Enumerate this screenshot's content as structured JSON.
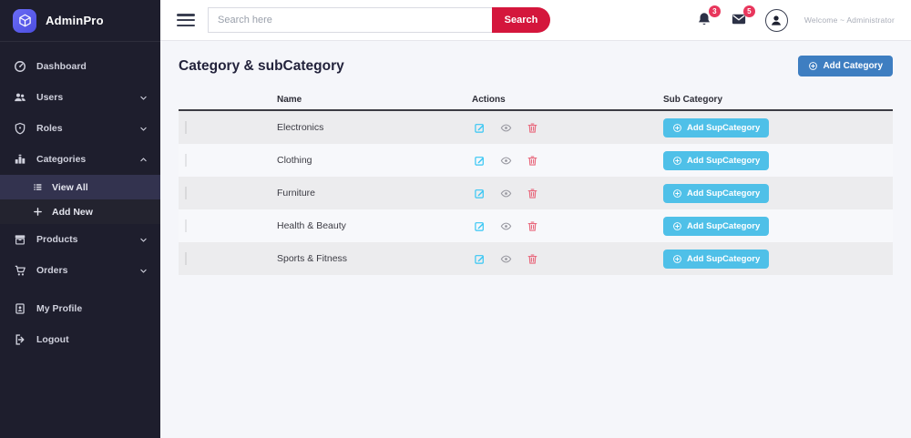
{
  "app": {
    "brand": "AdminPro"
  },
  "colors": {
    "sidebar_bg": "#1e1e2d",
    "sidebar_active_bg": "#33334f",
    "accent_red": "#d4163c",
    "badge_red": "#e8365c",
    "add_category_blue": "#3e7ec1",
    "add_subcategory_blue": "#4fc0e8",
    "edit_cyan": "#36c6f4",
    "trash_red": "#e8697d",
    "content_bg": "#f5f6fa"
  },
  "sidebar": {
    "items": [
      {
        "label": "Dashboard",
        "icon": "dashboard-icon"
      },
      {
        "label": "Users",
        "icon": "users-icon",
        "chevron": "down"
      },
      {
        "label": "Roles",
        "icon": "shield-icon",
        "chevron": "down"
      },
      {
        "label": "Categories",
        "icon": "categories-icon",
        "chevron": "up",
        "expanded": true
      },
      {
        "label": "View All",
        "icon": "list-icon",
        "active": true,
        "submenu_of": "Categories"
      },
      {
        "label": "Add New",
        "icon": "plus-icon",
        "submenu_of": "Categories"
      },
      {
        "label": "Products",
        "icon": "box-icon",
        "chevron": "down"
      },
      {
        "label": "Orders",
        "icon": "cart-icon",
        "chevron": "down"
      },
      {
        "label": "My Profile",
        "icon": "profile-card-icon"
      },
      {
        "label": "Logout",
        "icon": "logout-icon"
      }
    ]
  },
  "topbar": {
    "search_placeholder": "Search here",
    "search_button": "Search",
    "bell_badge": "3",
    "mail_badge": "5",
    "welcome": "Welcome ~ Administrator"
  },
  "page": {
    "title": "Category & subCategory",
    "add_category_button": "Add Category"
  },
  "table": {
    "headers": {
      "name": "Name",
      "actions": "Actions",
      "sub_category": "Sub Category"
    },
    "add_subcategory_button": "Add SupCategory",
    "row_actions": [
      "edit",
      "view",
      "delete"
    ],
    "rows": [
      {
        "name": "Electronics",
        "image": "electronics-thumbnail"
      },
      {
        "name": "Clothing",
        "image": "clothing-thumbnail"
      },
      {
        "name": "Furniture",
        "image": "furniture-thumbnail"
      },
      {
        "name": "Health & Beauty",
        "image": "health-beauty-thumbnail"
      },
      {
        "name": "Sports & Fitness",
        "image": "sports-fitness-thumbnail"
      }
    ]
  }
}
